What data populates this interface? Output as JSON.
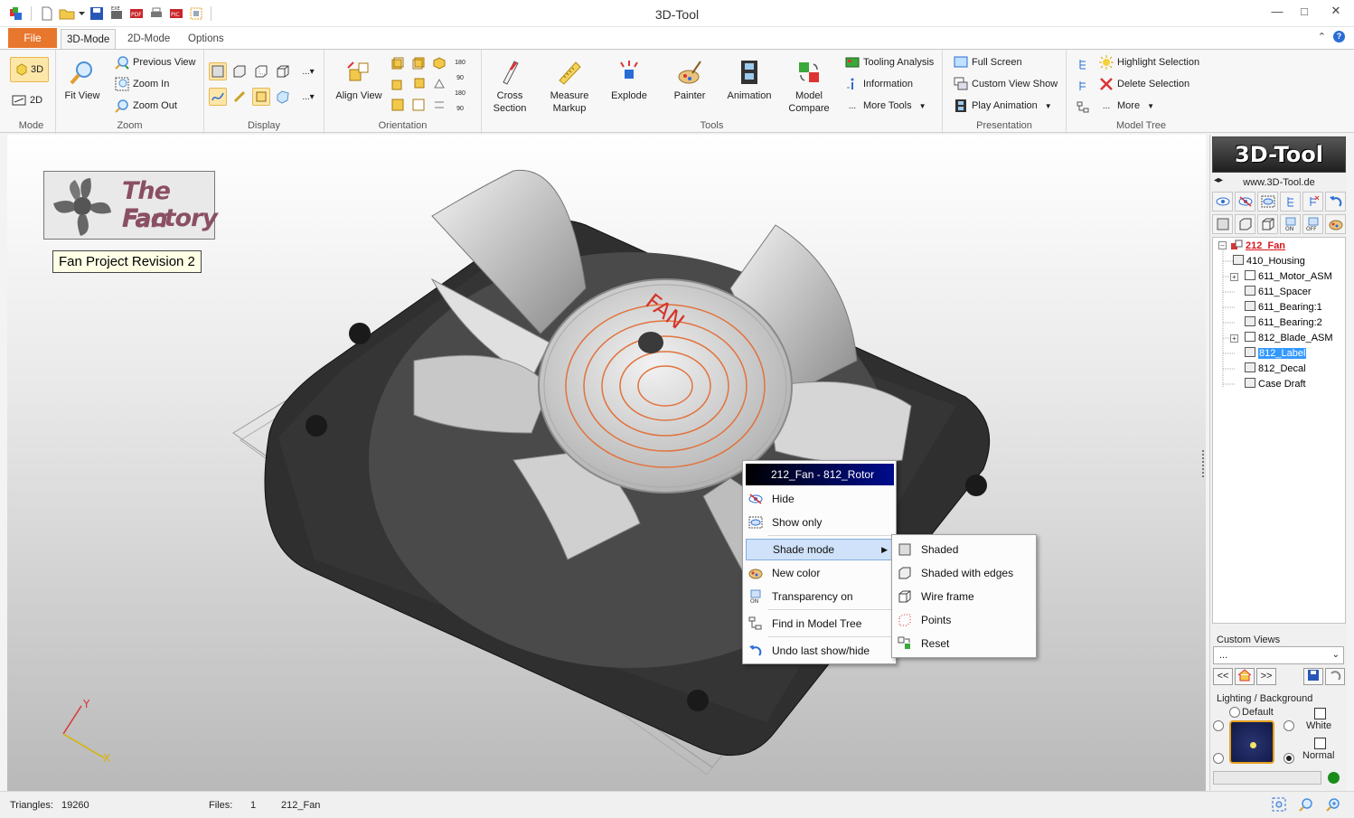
{
  "window": {
    "title": "3D-Tool"
  },
  "tabs": {
    "file": "File",
    "mode3d": "3D-Mode",
    "mode2d": "2D-Mode",
    "options": "Options"
  },
  "ribbon": {
    "mode": {
      "label": "Mode",
      "btn3d": "3D",
      "btn2d": "2D"
    },
    "zoom": {
      "label": "Zoom",
      "fit_view": "Fit View",
      "previous_view": "Previous View",
      "zoom_in": "Zoom In",
      "zoom_out": "Zoom Out"
    },
    "display": {
      "label": "Display"
    },
    "orientation": {
      "label": "Orientation",
      "align_view": "Align View",
      "rot_labels": [
        "180",
        "90",
        "180",
        "90"
      ]
    },
    "tools": {
      "label": "Tools",
      "cross_section_1": "Cross",
      "cross_section_2": "Section",
      "measure_1": "Measure",
      "measure_2": "Markup",
      "explode": "Explode",
      "painter": "Painter",
      "animation": "Animation",
      "model_compare_1": "Model",
      "model_compare_2": "Compare",
      "tooling_analysis": "Tooling Analysis",
      "information": "Information",
      "more_tools": "More Tools"
    },
    "presentation": {
      "label": "Presentation",
      "full_screen": "Full Screen",
      "custom_view_show": "Custom View Show",
      "play_animation": "Play Animation"
    },
    "model_tree": {
      "label": "Model Tree",
      "highlight_selection": "Highlight Selection",
      "delete_selection": "Delete Selection",
      "more": "More"
    }
  },
  "viewport": {
    "logo_line1": "The Fan",
    "logo_line2": "Factory",
    "project_label": "Fan Project Revision 2",
    "fan_label": "FAN",
    "axis_x": "X",
    "axis_y": "Y"
  },
  "context_menu": {
    "header": "212_Fan - 812_Rotor",
    "items": [
      "Hide",
      "Show only",
      "Shade mode",
      "New color",
      "Transparency on",
      "Find in Model Tree",
      "Undo last show/hide"
    ],
    "submenu": [
      "Shaded",
      "Shaded with edges",
      "Wire frame",
      "Points",
      "Reset"
    ]
  },
  "right_panel": {
    "brand": "3D-Tool",
    "url": "www.3D-Tool.de",
    "tree": {
      "root": "212_Fan",
      "children": [
        "410_Housing",
        "611_Motor_ASM",
        "611_Spacer",
        "611_Bearing:1",
        "611_Bearing:2",
        "812_Blade_ASM",
        "812_Label",
        "812_Decal",
        "Case Draft"
      ],
      "selected": "812_Label"
    },
    "custom_views": {
      "label": "Custom Views",
      "value": "..."
    },
    "lighting": {
      "label": "Lighting / Background",
      "default": "Default",
      "white": "White",
      "normal": "Normal"
    }
  },
  "status": {
    "triangles_label": "Triangles:",
    "triangles_value": "19260",
    "files_label": "Files:",
    "files_value": "1",
    "file_name": "212_Fan"
  },
  "colors": {
    "file_tab": "#e8772e",
    "tree_root": "#d9161d",
    "selection": "#3399ff",
    "menu_header": "#000c8c"
  }
}
